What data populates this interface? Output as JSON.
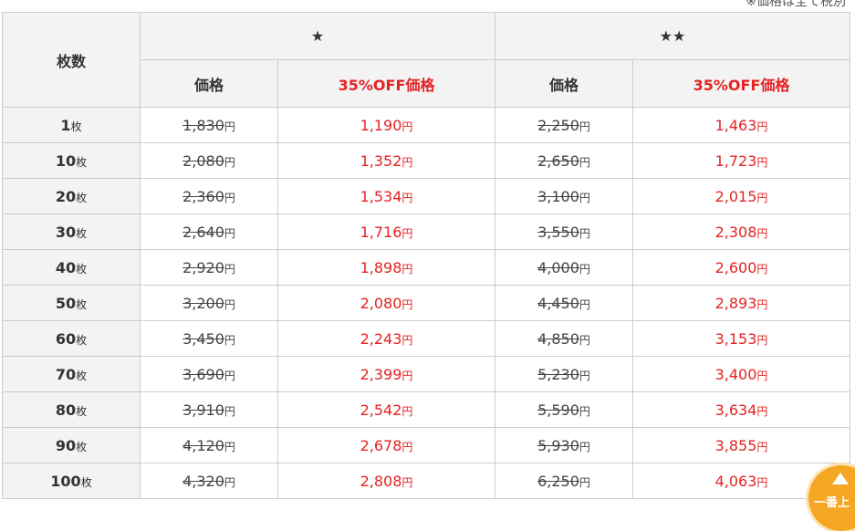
{
  "note": "※価格は全て税別",
  "table": {
    "qty_header": "枚数",
    "group_headers": [
      "★",
      "★★"
    ],
    "price_label": "価格",
    "sale_label": "35%OFF価格",
    "qty_unit": "枚",
    "yen_unit": "円",
    "rows": [
      {
        "qty": "1",
        "a_orig": "1,830",
        "a_sale": "1,190",
        "b_orig": "2,250",
        "b_sale": "1,463"
      },
      {
        "qty": "10",
        "a_orig": "2,080",
        "a_sale": "1,352",
        "b_orig": "2,650",
        "b_sale": "1,723"
      },
      {
        "qty": "20",
        "a_orig": "2,360",
        "a_sale": "1,534",
        "b_orig": "3,100",
        "b_sale": "2,015"
      },
      {
        "qty": "30",
        "a_orig": "2,640",
        "a_sale": "1,716",
        "b_orig": "3,550",
        "b_sale": "2,308"
      },
      {
        "qty": "40",
        "a_orig": "2,920",
        "a_sale": "1,898",
        "b_orig": "4,000",
        "b_sale": "2,600"
      },
      {
        "qty": "50",
        "a_orig": "3,200",
        "a_sale": "2,080",
        "b_orig": "4,450",
        "b_sale": "2,893"
      },
      {
        "qty": "60",
        "a_orig": "3,450",
        "a_sale": "2,243",
        "b_orig": "4,850",
        "b_sale": "3,153"
      },
      {
        "qty": "70",
        "a_orig": "3,690",
        "a_sale": "2,399",
        "b_orig": "5,230",
        "b_sale": "3,400"
      },
      {
        "qty": "80",
        "a_orig": "3,910",
        "a_sale": "2,542",
        "b_orig": "5,590",
        "b_sale": "3,634"
      },
      {
        "qty": "90",
        "a_orig": "4,120",
        "a_sale": "2,678",
        "b_orig": "5,930",
        "b_sale": "3,855"
      },
      {
        "qty": "100",
        "a_orig": "4,320",
        "a_sale": "2,808",
        "b_orig": "6,250",
        "b_sale": "4,063"
      }
    ]
  },
  "scroll_top": {
    "label": "一番上",
    "icon": "arrow-up-icon"
  },
  "colors": {
    "accent_red": "#e52222",
    "header_bg": "#f3f3f3",
    "border": "#cccccc",
    "scroll_button": "#f5a623"
  }
}
